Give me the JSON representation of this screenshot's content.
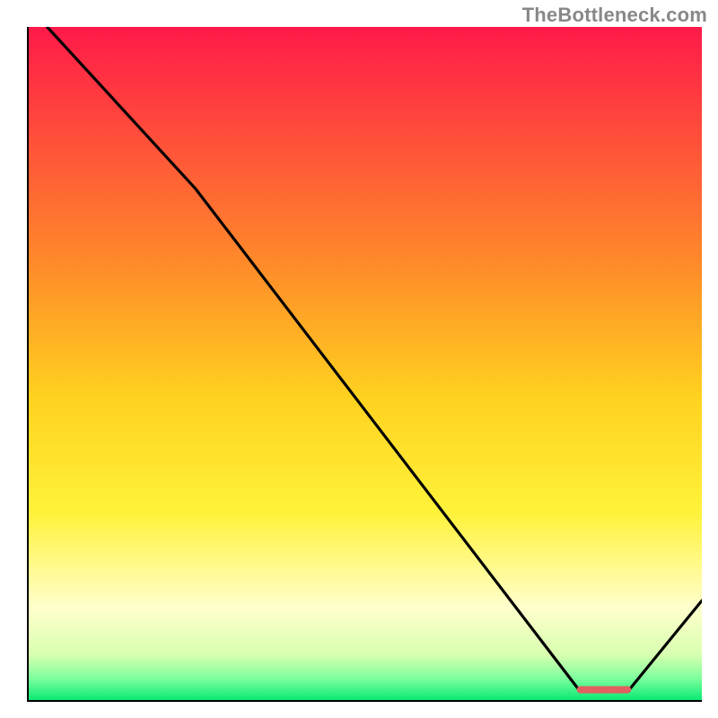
{
  "watermark": "TheBottleneck.com",
  "chart_data": {
    "type": "line",
    "title": "",
    "xlabel": "",
    "ylabel": "",
    "xlim": [
      0,
      100
    ],
    "ylim": [
      0,
      100
    ],
    "series": [
      {
        "name": "curve",
        "x": [
          3,
          25,
          82,
          89,
          100
        ],
        "y": [
          100,
          76,
          1.5,
          1.5,
          15
        ]
      }
    ],
    "marker_band": {
      "x_start": 82,
      "x_end": 89,
      "y": 1.8
    },
    "gradient_stops": [
      {
        "offset": 0.0,
        "color": "#ff1a49"
      },
      {
        "offset": 0.35,
        "color": "#ff8a2a"
      },
      {
        "offset": 0.55,
        "color": "#ffd21f"
      },
      {
        "offset": 0.72,
        "color": "#fff23a"
      },
      {
        "offset": 0.86,
        "color": "#ffffcc"
      },
      {
        "offset": 0.93,
        "color": "#d8ffb0"
      },
      {
        "offset": 0.965,
        "color": "#7eff9e"
      },
      {
        "offset": 1.0,
        "color": "#00e870"
      }
    ],
    "axis_color": "#000000",
    "line_color": "#000000",
    "marker_color": "#e25f5f"
  }
}
